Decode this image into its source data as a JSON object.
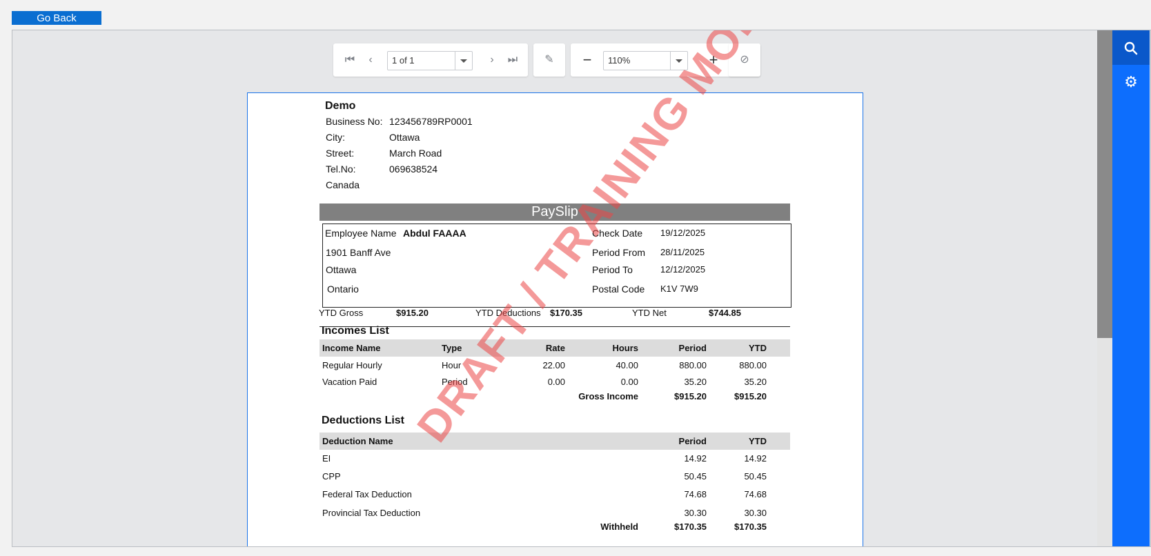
{
  "go_back_label": "Go Back",
  "toolbar": {
    "page_value": "1 of 1",
    "zoom_value": "110%"
  },
  "company": {
    "name": "Demo",
    "fields": [
      {
        "label": "Business No:",
        "value": "123456789RP0001"
      },
      {
        "label": "City:",
        "value": "Ottawa"
      },
      {
        "label": "Street:",
        "value": "March Road"
      },
      {
        "label": "Tel.No:",
        "value": "069638524"
      }
    ],
    "country": "Canada"
  },
  "payslip_title": "PaySlip",
  "employee": {
    "name_label": "Employee Name",
    "name": "Abdul FAAAA",
    "address_lines": [
      "1901 Banff Ave",
      "Ottawa",
      "Ontario"
    ],
    "right_fields": [
      {
        "label": "Check Date",
        "value": "19/12/2025"
      },
      {
        "label": "Period From",
        "value": "28/11/2025"
      },
      {
        "label": "Period To",
        "value": "12/12/2025"
      },
      {
        "label": "Postal Code",
        "value": "K1V 7W9"
      }
    ]
  },
  "ytd": [
    {
      "label": "YTD Gross",
      "value": "$915.20"
    },
    {
      "label": "YTD Deductions",
      "value": "$170.35"
    },
    {
      "label": "YTD Net",
      "value": "$744.85"
    }
  ],
  "incomes": {
    "title": "Incomes List",
    "headers": [
      "Income Name",
      "Type",
      "Rate",
      "Hours",
      "Period",
      "YTD"
    ],
    "rows": [
      [
        "Regular Hourly",
        "Hour",
        "22.00",
        "40.00",
        "880.00",
        "880.00"
      ],
      [
        "Vacation Paid",
        "Period",
        "0.00",
        "0.00",
        "35.20",
        "35.20"
      ]
    ],
    "total_label": "Gross Income",
    "total_period": "$915.20",
    "total_ytd": "$915.20"
  },
  "deductions": {
    "title": "Deductions List",
    "headers": [
      "Deduction Name",
      "Period",
      "YTD"
    ],
    "rows": [
      [
        "EI",
        "14.92",
        "14.92"
      ],
      [
        "CPP",
        "50.45",
        "50.45"
      ],
      [
        "Federal Tax Deduction",
        "74.68",
        "74.68"
      ],
      [
        "Provincial Tax Deduction",
        "30.30",
        "30.30"
      ]
    ],
    "total_label": "Withheld",
    "total_period": "$170.35",
    "total_ytd": "$170.35"
  },
  "watermark": "DRAFT / TRAINING MODE",
  "colors": {
    "accent": "#0d6efd",
    "button": "#0a6ed1",
    "watermark": "#eb4646"
  }
}
